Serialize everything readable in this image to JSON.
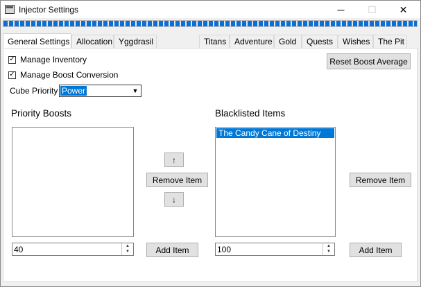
{
  "window": {
    "title": "Injector Settings",
    "controls": {
      "minimize": "─",
      "maximize": "☐",
      "close": "✕"
    },
    "progress_fraction": 1.0
  },
  "tabs_left": [
    "General Settings",
    "Allocation",
    "Yggdrasil"
  ],
  "tabs_right": [
    "Titans",
    "Adventure",
    "Gold",
    "Quests",
    "Wishes",
    "The Pit"
  ],
  "active_tab": "General Settings",
  "settings": {
    "manage_inventory": {
      "label": "Manage Inventory",
      "checked": true,
      "mark": "✓"
    },
    "manage_boost_conversion": {
      "label": "Manage Boost Conversion",
      "checked": true,
      "mark": "✓"
    },
    "cube_priority": {
      "label": "Cube Priority",
      "value": "Power",
      "arrow": "▼"
    },
    "reset_boost_average_label": "Reset Boost Average"
  },
  "priority_boosts": {
    "heading": "Priority Boosts",
    "items": [],
    "up_label": "↑",
    "down_label": "↓",
    "remove_label": "Remove Item",
    "add_value": "40",
    "add_label": "Add Item"
  },
  "blacklisted_items": {
    "heading": "Blacklisted Items",
    "items": [
      "The Candy Cane of Destiny"
    ],
    "remove_label": "Remove Item",
    "add_value": "100",
    "add_label": "Add Item"
  },
  "spinner": {
    "up": "▲",
    "down": "▼"
  },
  "colors": {
    "accent": "#0078d7",
    "progress": "#0a6fd6",
    "button_bg": "#e1e1e1"
  }
}
